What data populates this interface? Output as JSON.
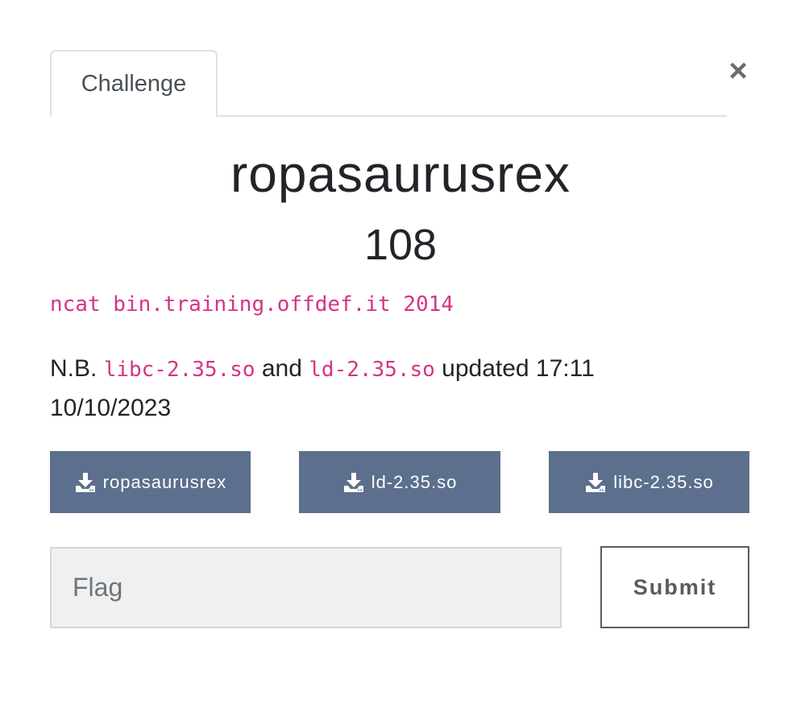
{
  "tabs": [
    {
      "label": "Challenge"
    }
  ],
  "close": {
    "glyph": "×"
  },
  "challenge": {
    "name": "ropasaurusrex",
    "value": "108",
    "connection": "ncat bin.training.offdef.it 2014",
    "note": {
      "prefix": "N.B. ",
      "file1": "libc-2.35.so",
      "mid": " and ",
      "file2": "ld-2.35.so",
      "suffix": " updated 17:11 10/10/2023"
    }
  },
  "downloads": [
    {
      "label": "ropasaurusrex",
      "icon": "download-icon"
    },
    {
      "label": "ld-2.35.so",
      "icon": "download-icon"
    },
    {
      "label": "libc-2.35.so",
      "icon": "download-icon"
    }
  ],
  "form": {
    "flag_placeholder": "Flag",
    "flag_value": "",
    "submit_label": "Submit"
  },
  "colors": {
    "download_button_bg": "#5c6f8c",
    "code_pink": "#d63384",
    "submit_border": "#5b5b5b"
  }
}
